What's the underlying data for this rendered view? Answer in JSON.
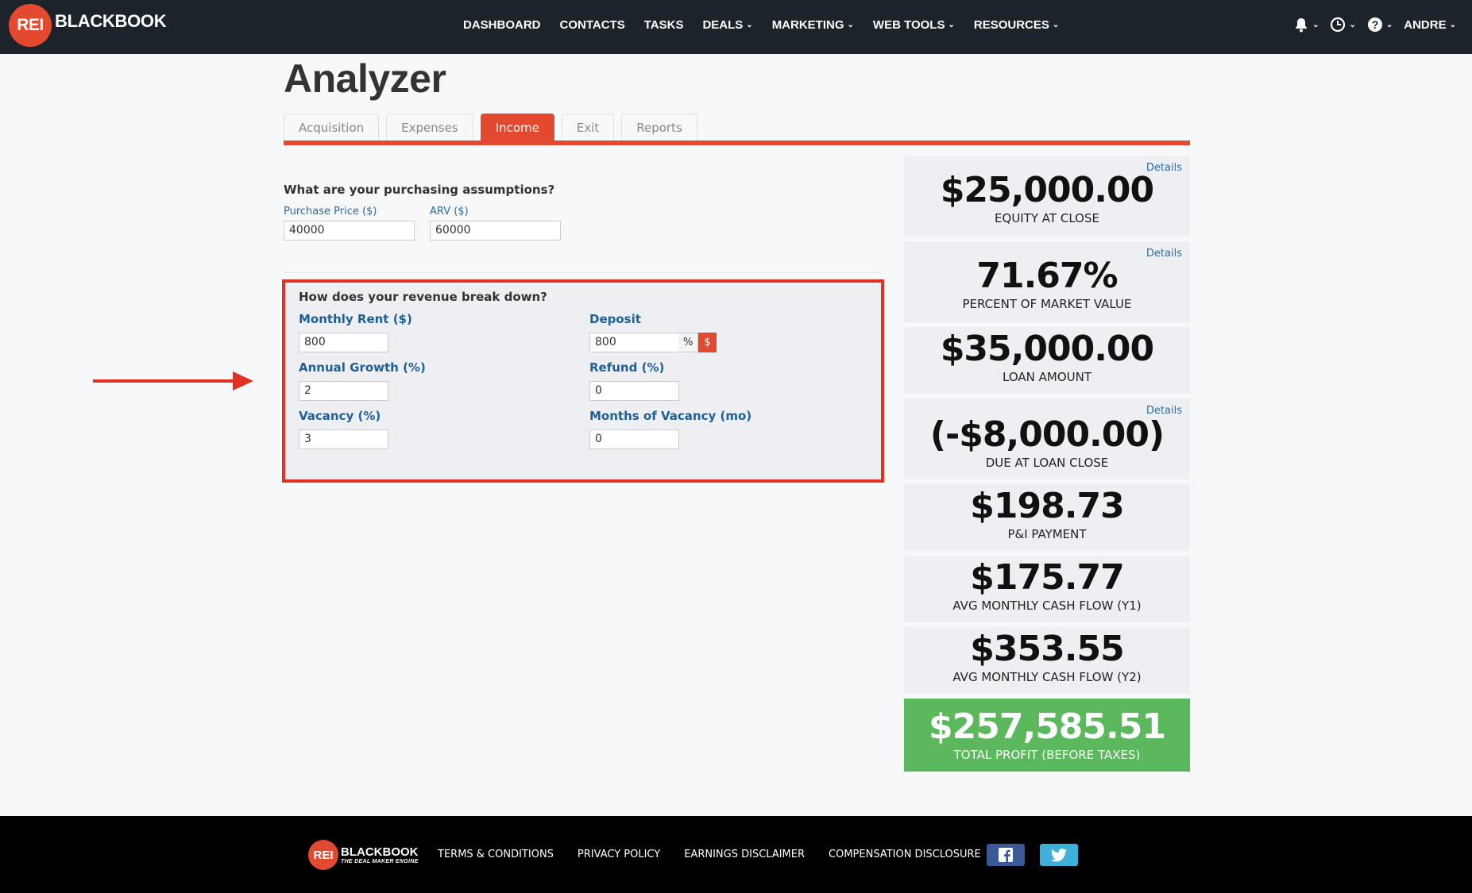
{
  "brand": {
    "logo_mark": "REI",
    "logo_text": "BLACKBOOK",
    "footer_tagline": "THE DEAL MAKER ENGINE"
  },
  "nav": {
    "items": [
      {
        "label": "DASHBOARD",
        "dropdown": false
      },
      {
        "label": "CONTACTS",
        "dropdown": false
      },
      {
        "label": "TASKS",
        "dropdown": false
      },
      {
        "label": "DEALS",
        "dropdown": true
      },
      {
        "label": "MARKETING",
        "dropdown": true
      },
      {
        "label": "WEB TOOLS",
        "dropdown": true
      },
      {
        "label": "RESOURCES",
        "dropdown": true
      }
    ],
    "right": {
      "notifications_icon": "bell-icon",
      "history_icon": "clock-icon",
      "help_icon": "question-icon",
      "user": "ANDRE"
    }
  },
  "page": {
    "title": "Analyzer",
    "tabs": [
      "Acquisition",
      "Expenses",
      "Income",
      "Exit",
      "Reports"
    ],
    "active_tab": "Income"
  },
  "purchasing": {
    "question": "What are your purchasing assumptions?",
    "purchase_price_label": "Purchase Price ($)",
    "purchase_price": "40000",
    "arv_label": "ARV ($)",
    "arv": "60000"
  },
  "revenue": {
    "question": "How does your revenue break down?",
    "monthly_rent_label": "Monthly Rent ($)",
    "monthly_rent": "800",
    "annual_growth_label": "Annual Growth (%)",
    "annual_growth": "2",
    "vacancy_label": "Vacancy (%)",
    "vacancy": "3",
    "deposit_label": "Deposit",
    "deposit": "800",
    "deposit_unit_pct": "%",
    "deposit_unit_dollar": "$",
    "refund_label": "Refund (%)",
    "refund": "0",
    "months_vacancy_label": "Months of Vacancy (mo)",
    "months_vacancy": "0"
  },
  "summary": {
    "details_label": "Details",
    "cards": [
      {
        "value": "$25,000.00",
        "label": "EQUITY AT CLOSE",
        "has_details": true
      },
      {
        "value": "71.67%",
        "label": "PERCENT OF MARKET VALUE",
        "has_details": true
      },
      {
        "value": "$35,000.00",
        "label": "LOAN AMOUNT",
        "has_details": false
      },
      {
        "value": "(-$8,000.00)",
        "label": "DUE AT LOAN CLOSE",
        "has_details": true
      },
      {
        "value": "$198.73",
        "label": "P&I PAYMENT",
        "has_details": false
      },
      {
        "value": "$175.77",
        "label": "AVG MONTHLY CASH FLOW (Y1)",
        "has_details": false
      },
      {
        "value": "$353.55",
        "label": "AVG MONTHLY CASH FLOW (Y2)",
        "has_details": false
      },
      {
        "value": "$257,585.51",
        "label": "TOTAL PROFIT (BEFORE TAXES)",
        "has_details": false
      }
    ]
  },
  "footer": {
    "links": [
      "TERMS & CONDITIONS",
      "PRIVACY POLICY",
      "EARNINGS DISCLAIMER",
      "COMPENSATION DISCLOSURE"
    ]
  },
  "colors": {
    "accent": "#e2492f",
    "nav_bg": "#1c232b",
    "highlight_box": "#e03222",
    "profit_green": "#5cb85c",
    "link_blue": "#2c6aa0"
  }
}
